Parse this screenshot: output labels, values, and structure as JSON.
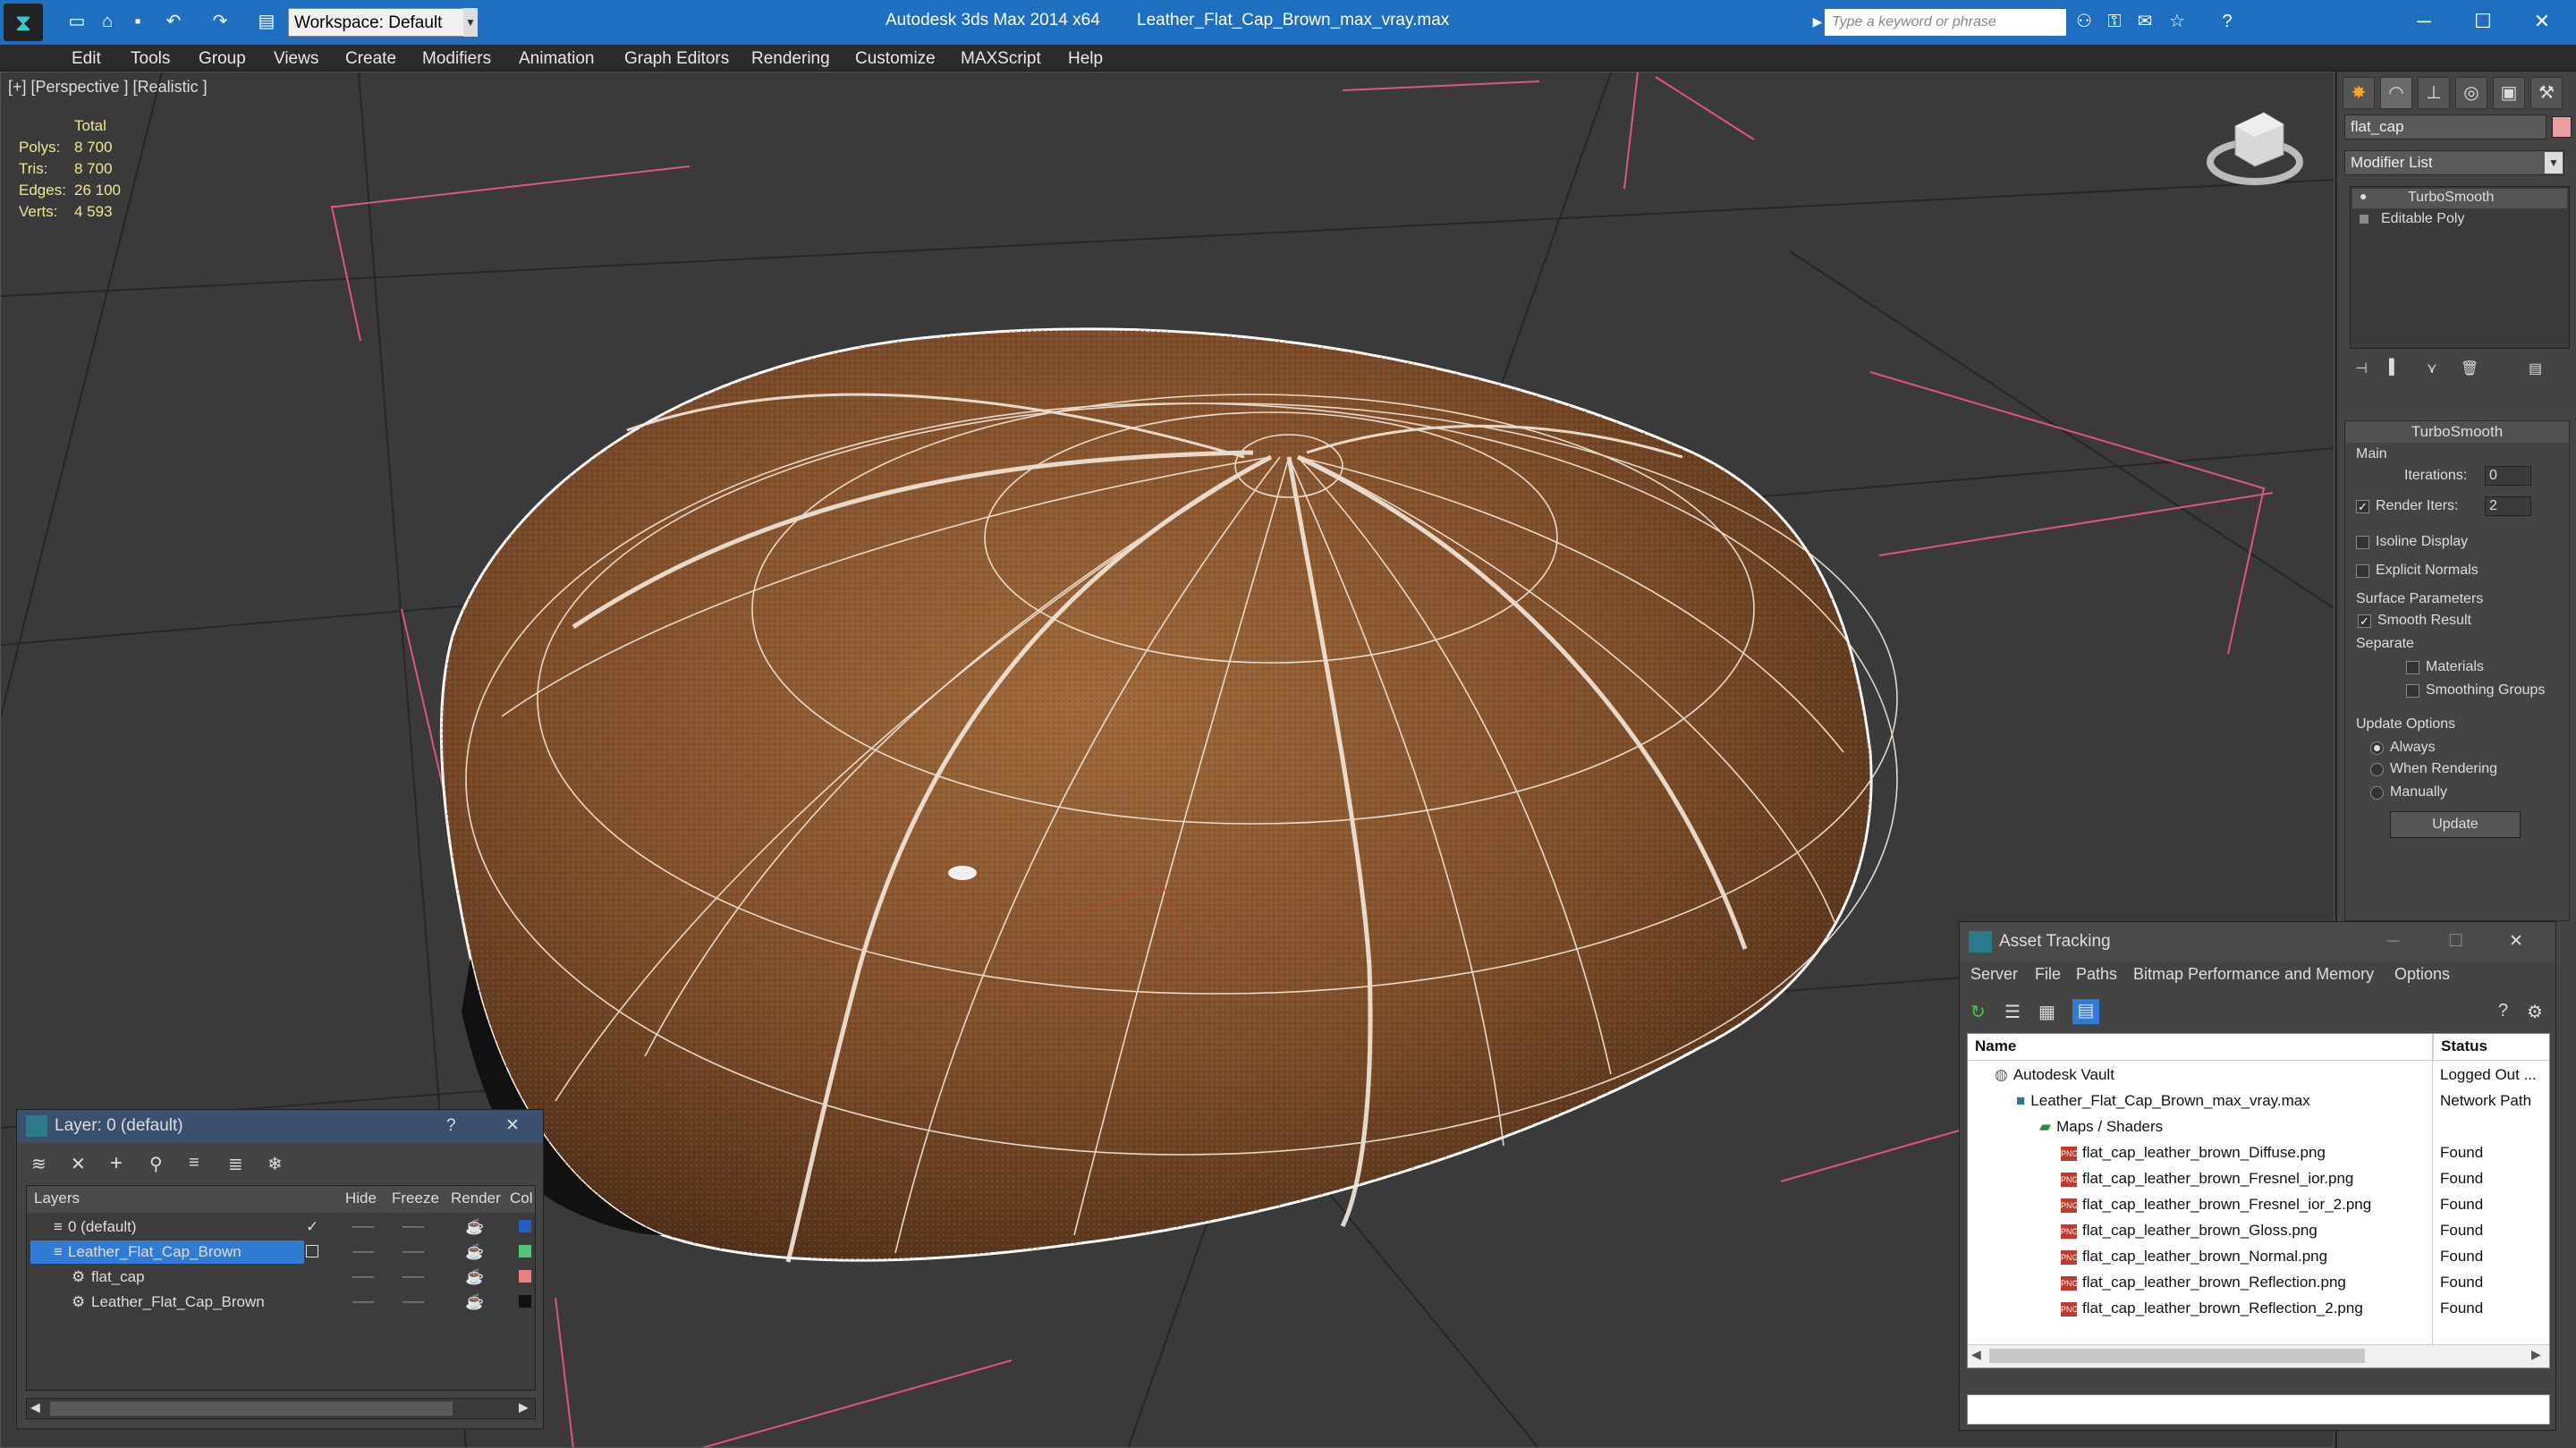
{
  "app": {
    "title": "Autodesk 3ds Max  2014 x64",
    "file": "Leather_Flat_Cap_Brown_max_vray.max",
    "workspace": "Workspace: Default",
    "search_placeholder": "Type a keyword or phrase"
  },
  "menu": [
    "Edit",
    "Tools",
    "Group",
    "Views",
    "Create",
    "Modifiers",
    "Animation",
    "Graph Editors",
    "Rendering",
    "Customize",
    "MAXScript",
    "Help"
  ],
  "viewport": {
    "label": "[+] [Perspective ] [Realistic ]",
    "stats": {
      "header": "Total",
      "rows": [
        {
          "k": "Polys:",
          "v": "8 700"
        },
        {
          "k": "Tris:",
          "v": "8 700"
        },
        {
          "k": "Edges:",
          "v": "26 100"
        },
        {
          "k": "Verts:",
          "v": "4 593"
        }
      ]
    }
  },
  "command_panel": {
    "object_name": "flat_cap",
    "modifier_list": "Modifier List",
    "stack": [
      "TurboSmooth",
      "Editable Poly"
    ],
    "rollout_title": "TurboSmooth",
    "main_label": "Main",
    "iterations_label": "Iterations:",
    "iterations_value": "0",
    "render_iters_label": "Render Iters:",
    "render_iters_value": "2",
    "isoline": "Isoline Display",
    "explicit_normals": "Explicit Normals",
    "surface_params": "Surface Parameters",
    "smooth_result": "Smooth Result",
    "separate": "Separate",
    "materials": "Materials",
    "smoothing_groups": "Smoothing Groups",
    "update_options": "Update Options",
    "always": "Always",
    "when_rendering": "When Rendering",
    "manually": "Manually",
    "update_button": "Update"
  },
  "layer_panel": {
    "title": "Layer: 0 (default)",
    "help": "?",
    "columns": {
      "layers": "Layers",
      "hide": "Hide",
      "freeze": "Freeze",
      "render": "Render",
      "color": "Col"
    },
    "rows": [
      {
        "name": "0 (default)",
        "color": "#2060c0"
      },
      {
        "name": "Leather_Flat_Cap_Brown",
        "color": "#50c878"
      },
      {
        "name": "flat_cap",
        "color": "#e88080"
      },
      {
        "name": "Leather_Flat_Cap_Brown",
        "color": "#111111"
      }
    ]
  },
  "asset_tracking": {
    "title": "Asset Tracking",
    "menu": [
      "Server",
      "File",
      "Paths",
      "Bitmap Performance and Memory",
      "Options"
    ],
    "columns": {
      "name": "Name",
      "status": "Status"
    },
    "rows": [
      {
        "name": "Autodesk Vault",
        "status": "Logged Out ..."
      },
      {
        "name": "Leather_Flat_Cap_Brown_max_vray.max",
        "status": "Network Path"
      },
      {
        "name": "Maps / Shaders",
        "status": ""
      },
      {
        "name": "flat_cap_leather_brown_Diffuse.png",
        "status": "Found"
      },
      {
        "name": "flat_cap_leather_brown_Fresnel_ior.png",
        "status": "Found"
      },
      {
        "name": "flat_cap_leather_brown_Fresnel_ior_2.png",
        "status": "Found"
      },
      {
        "name": "flat_cap_leather_brown_Gloss.png",
        "status": "Found"
      },
      {
        "name": "flat_cap_leather_brown_Normal.png",
        "status": "Found"
      },
      {
        "name": "flat_cap_leather_brown_Reflection.png",
        "status": "Found"
      },
      {
        "name": "flat_cap_leather_brown_Reflection_2.png",
        "status": "Found"
      }
    ]
  },
  "colors": {
    "titlebar": "#1f6fc0",
    "selection": "#2f7bd6",
    "leather": "#8b5a33"
  }
}
